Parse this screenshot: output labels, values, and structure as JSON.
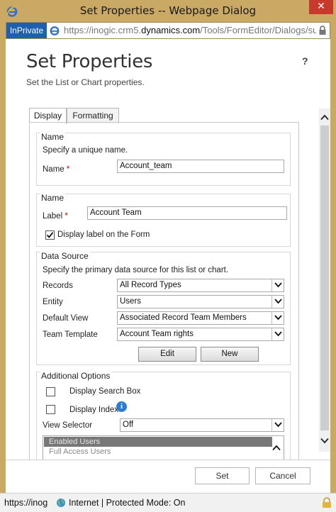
{
  "window": {
    "title": "Set Properties -- Webpage Dialog",
    "close_label": "✕"
  },
  "address": {
    "inprivate_label": "InPrivate",
    "url_prefix": "https://inogic.crm5.",
    "url_domain": "dynamics.com",
    "url_suffix": "/Tools/FormEditor/Dialogs/subGri"
  },
  "dialog": {
    "title": "Set Properties",
    "help": "?",
    "subtitle": "Set the List or Chart properties."
  },
  "tabs": [
    {
      "label": "Display",
      "active": true
    },
    {
      "label": "Formatting",
      "active": false
    }
  ],
  "name_section": {
    "title": "Name",
    "hint": "Specify a unique name.",
    "name_label": "Name",
    "name_value": "Account_team"
  },
  "label_section": {
    "title": "Name",
    "label_label": "Label",
    "label_value": "Account Team",
    "display_label_text": "Display label on the Form",
    "display_label_checked": true
  },
  "data_source": {
    "title": "Data Source",
    "hint": "Specify the primary data source for this list or chart.",
    "records_label": "Records",
    "records_value": "All Record Types",
    "entity_label": "Entity",
    "entity_value": "Users",
    "default_view_label": "Default View",
    "default_view_value": "Associated Record Team Members",
    "team_template_label": "Team Template",
    "team_template_value": "Account Team rights",
    "edit_label": "Edit",
    "new_label": "New"
  },
  "additional": {
    "title": "Additional Options",
    "search_box_label": "Display Search Box",
    "search_box_checked": false,
    "index_label": "Display Index",
    "index_checked": false,
    "view_selector_label": "View Selector",
    "view_selector_value": "Off",
    "views": [
      {
        "label": "Enabled Users",
        "selected": true
      },
      {
        "label": "Full Access Users",
        "selected": false
      }
    ]
  },
  "footer": {
    "set_label": "Set",
    "cancel_label": "Cancel"
  },
  "status": {
    "url": "https://inog",
    "zone": "Internet | Protected Mode: On"
  },
  "colors": {
    "frame": "#c9a963",
    "inprivate": "#1f5fb0",
    "required": "#cc0000",
    "close": "#c7392b"
  }
}
